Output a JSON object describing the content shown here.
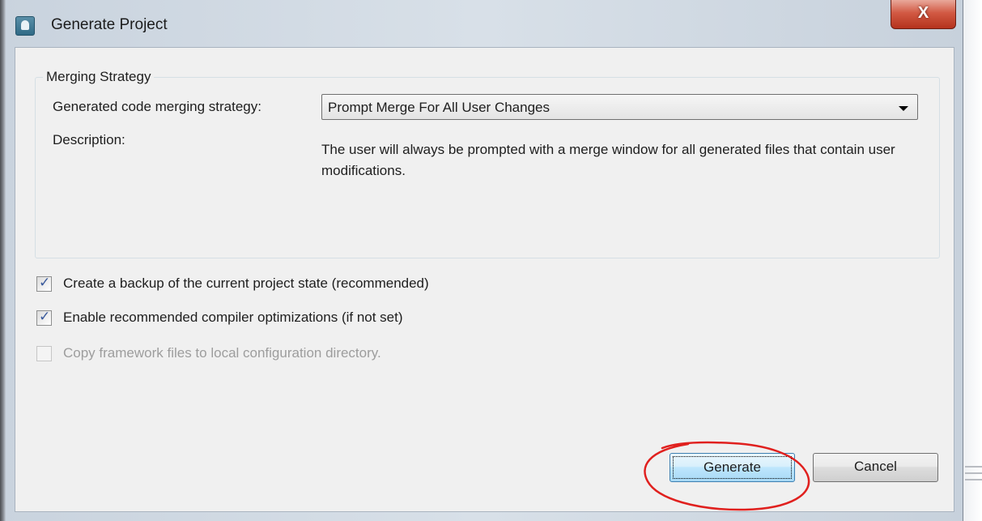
{
  "window": {
    "title": "Generate Project",
    "close_label": "X"
  },
  "merging_strategy": {
    "group_title": "Merging Strategy",
    "strategy_label": "Generated code merging strategy:",
    "strategy_selected": "Prompt Merge For All User Changes",
    "description_label": "Description:",
    "description_text": "The user will always be prompted with a merge window for all generated files that contain user modifications."
  },
  "options": [
    {
      "label": "Create a backup of the current project state (recommended)",
      "checked": true,
      "enabled": true
    },
    {
      "label": "Enable recommended compiler optimizations (if not set)",
      "checked": true,
      "enabled": true
    },
    {
      "label": "Copy framework files to local configuration directory.",
      "checked": false,
      "enabled": false
    }
  ],
  "buttons": {
    "generate_label": "Generate",
    "cancel_label": "Cancel"
  },
  "colors": {
    "annotation_circle": "#e0201e",
    "accent_button_border": "#3c7fb1",
    "close_button": "#c8442e"
  },
  "icons": {
    "app": "app-icon",
    "close": "close-icon",
    "dropdown": "chevron-down-icon",
    "check": "checkmark-icon"
  }
}
